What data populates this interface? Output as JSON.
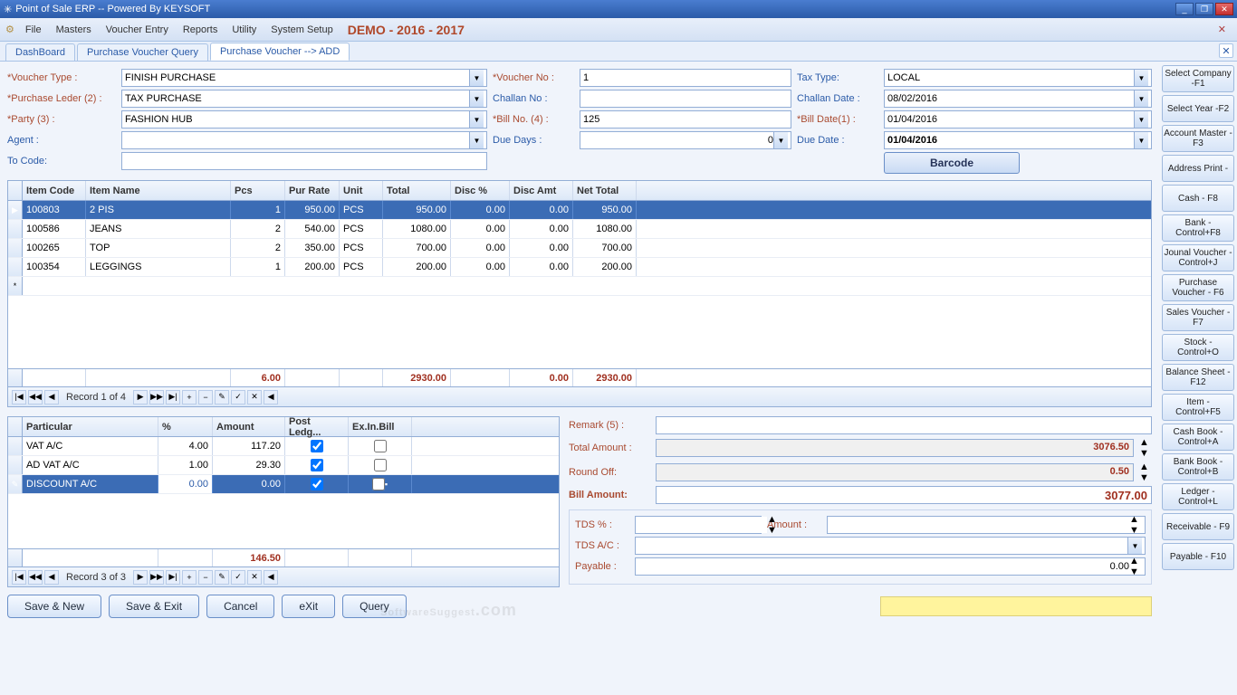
{
  "window": {
    "title": "Point of Sale ERP -- Powered By KEYSOFT"
  },
  "menu": {
    "file": "File",
    "masters": "Masters",
    "voucher": "Voucher Entry",
    "reports": "Reports",
    "utility": "Utility",
    "setup": "System Setup",
    "demo": "DEMO - 2016 - 2017"
  },
  "tabs": [
    {
      "label": "DashBoard"
    },
    {
      "label": "Purchase Voucher Query"
    },
    {
      "label": "Purchase Voucher --> ADD"
    }
  ],
  "sidebar": [
    "Select Company -F1",
    "Select Year -F2",
    "Account Master - F3",
    "Address Print -",
    "Cash - F8",
    "Bank - Control+F8",
    "Jounal Voucher - Control+J",
    "Purchase Voucher - F6",
    "Sales Voucher - F7",
    "Stock - Control+O",
    "Balance Sheet - F12",
    "Item - Control+F5",
    "Cash Book - Control+A",
    "Bank Book - Control+B",
    "Ledger - Control+L",
    "Receivable - F9",
    "Payable - F10"
  ],
  "form": {
    "voucherType": {
      "label": "*Voucher Type :",
      "value": "FINISH PURCHASE"
    },
    "purchaseLedger": {
      "label": "*Purchase Leder (2) :",
      "value": "TAX PURCHASE"
    },
    "party": {
      "label": "*Party (3) :",
      "value": "FASHION HUB"
    },
    "agent": {
      "label": "Agent  :",
      "value": ""
    },
    "toCode": {
      "label": "To Code:",
      "value": ""
    },
    "voucherNo": {
      "label": "*Voucher No :",
      "value": "1"
    },
    "challanNo": {
      "label": "Challan No :",
      "value": ""
    },
    "billNo": {
      "label": "*Bill No. (4) :",
      "value": "125"
    },
    "dueDays": {
      "label": "Due Days :",
      "value": "0"
    },
    "taxType": {
      "label": "Tax Type:",
      "value": "LOCAL"
    },
    "challanDate": {
      "label": "Challan Date :",
      "value": "08/02/2016"
    },
    "billDate": {
      "label": "*Bill Date(1) :",
      "value": "01/04/2016"
    },
    "dueDate": {
      "label": "Due Date :",
      "value": "01/04/2016"
    },
    "barcode": "Barcode"
  },
  "itemGrid": {
    "headers": [
      "Item Code",
      "Item Name",
      "Pcs",
      "Pur Rate",
      "Unit",
      "Total",
      "Disc %",
      "Disc Amt",
      "Net Total"
    ],
    "rows": [
      {
        "code": "100803",
        "name": "2 PIS",
        "pcs": "1",
        "rate": "950.00",
        "unit": "PCS",
        "total": "950.00",
        "discp": "0.00",
        "discamt": "0.00",
        "net": "950.00"
      },
      {
        "code": "100586",
        "name": "JEANS",
        "pcs": "2",
        "rate": "540.00",
        "unit": "PCS",
        "total": "1080.00",
        "discp": "0.00",
        "discamt": "0.00",
        "net": "1080.00"
      },
      {
        "code": "100265",
        "name": "TOP",
        "pcs": "2",
        "rate": "350.00",
        "unit": "PCS",
        "total": "700.00",
        "discp": "0.00",
        "discamt": "0.00",
        "net": "700.00"
      },
      {
        "code": "100354",
        "name": "LEGGINGS",
        "pcs": "1",
        "rate": "200.00",
        "unit": "PCS",
        "total": "200.00",
        "discp": "0.00",
        "discamt": "0.00",
        "net": "200.00"
      }
    ],
    "totals": {
      "pcs": "6.00",
      "total": "2930.00",
      "discamt": "0.00",
      "net": "2930.00"
    },
    "nav": "Record 1 of 4"
  },
  "ledgerGrid": {
    "headers": [
      "Particular",
      "%",
      "Amount",
      "Post Ledg...",
      "Ex.In.Bill"
    ],
    "rows": [
      {
        "name": "VAT A/C",
        "pct": "4.00",
        "amt": "117.20",
        "post": true,
        "exin": false
      },
      {
        "name": "AD VAT A/C",
        "pct": "1.00",
        "amt": "29.30",
        "post": true,
        "exin": false
      },
      {
        "name": "DISCOUNT A/C",
        "pct": "0.00",
        "amt": "0.00",
        "post": true,
        "exin": false
      }
    ],
    "total": "146.50",
    "nav": "Record 3 of 3"
  },
  "summary": {
    "remark": {
      "label": "Remark (5) :",
      "value": ""
    },
    "totalAmt": {
      "label": "Total Amount :",
      "value": "3076.50"
    },
    "roundOff": {
      "label": "Round Off:",
      "value": "0.50"
    },
    "billAmt": {
      "label": "Bill Amount:",
      "value": "3077.00"
    },
    "tdsPct": {
      "label": "TDS % :",
      "value": ""
    },
    "amount": {
      "label": "Amount :",
      "value": ""
    },
    "tdsAc": {
      "label": "TDS A/C :",
      "value": ""
    },
    "payable": {
      "label": "Payable :",
      "value": "0.00"
    }
  },
  "buttons": {
    "saveNew": "Save & New",
    "saveExit": "Save & Exit",
    "cancel": "Cancel",
    "exit": "eXit",
    "query": "Query"
  },
  "watermark": "SoftwareSuggest",
  "watermarkCom": ".com"
}
